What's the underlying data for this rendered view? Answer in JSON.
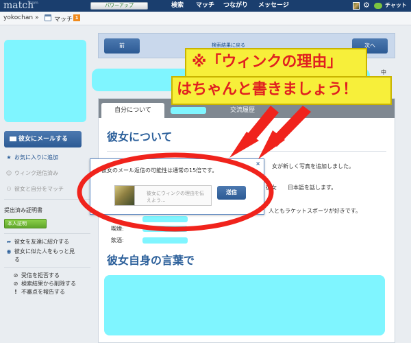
{
  "topbar": {
    "logo": "match",
    "logo_badge": "com",
    "upgrade": "パワーアップ",
    "nav": [
      "検索",
      "マッチ",
      "つながり",
      "メッセージ"
    ],
    "chat": "チャット"
  },
  "subbar": {
    "username": "yokochan »",
    "match_label": "マッチ",
    "match_count": "1"
  },
  "sidebar": {
    "mail_button": "彼女にメールする",
    "favorite": "お気に入りに追加",
    "wink_sent": "ウィンク送信済み",
    "match_with_me": "彼女と自分をマッチ",
    "cert_title": "提出済み証明書",
    "cert_badge": "本人証明",
    "introduce": "彼女を友達に紹介する",
    "similar_line1": "彼女に似た人をもっと見",
    "similar_line2": "る",
    "block": "受信を拒否する",
    "remove": "検索結果から削除する",
    "report": "不審点を報告する"
  },
  "navpanel": {
    "prev": "前",
    "back": "検索結果に戻る",
    "next": "次へ"
  },
  "header": {
    "online_frag": "中"
  },
  "tabs": {
    "about_self": "自分について",
    "history": "交流履歴"
  },
  "about": {
    "heading": "彼女について",
    "line1_tail": "女が新しく写真を追加しました。",
    "line2_a": "彼女",
    "line2_b": "日本語を話します。",
    "line3": "人ともラケットスポーツが好きです。",
    "smoking": "喫煙:",
    "drinking": "飲酒:"
  },
  "self_words": {
    "heading": "彼女自身の言葉で"
  },
  "wink_popup": {
    "close": "×",
    "message": "彼女のメール返信の可能性は通常の15倍です。",
    "placeholder": "彼女にウィンクの理由を伝えよう...",
    "send": "送信"
  },
  "annotation": {
    "line1": "※「ウィンクの理由」",
    "line2": "はちゃんと書きましょう！"
  },
  "colors": {
    "navy": "#1a3e6e",
    "button_blue": "#2c5a94",
    "redaction": "#7ff5ff",
    "annotation_red": "#e02020",
    "annotation_yellow": "#f7ef3a",
    "green_badge": "#5fa62a"
  }
}
